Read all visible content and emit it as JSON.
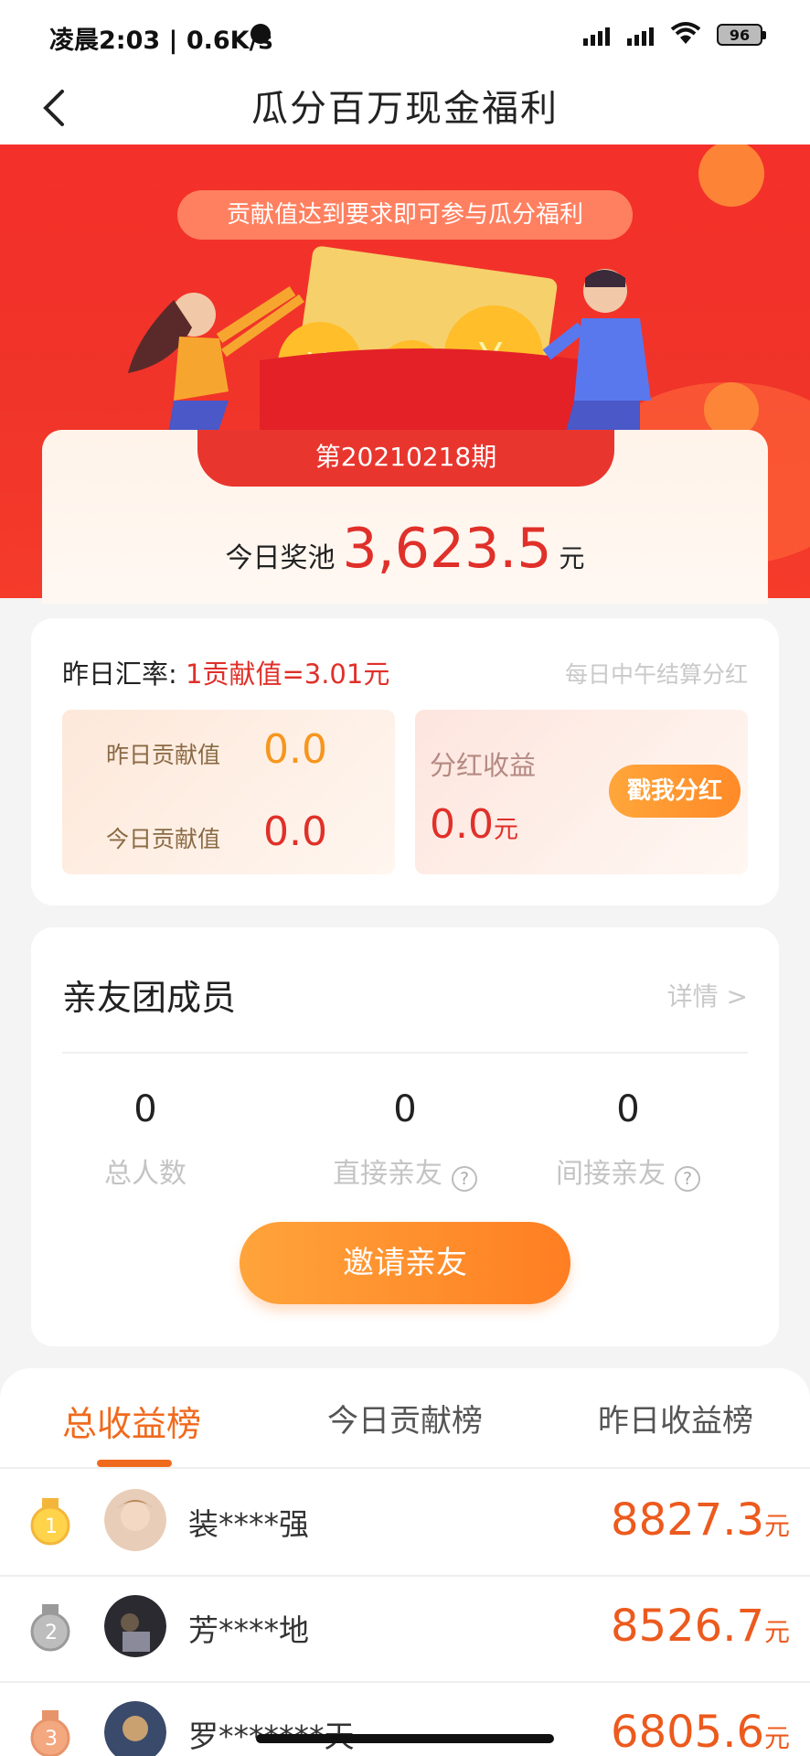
{
  "status_bar": {
    "time": "凌晨2:03 | 0.6K/s",
    "battery": "96"
  },
  "header": {
    "title": "瓜分百万现金福利"
  },
  "hero": {
    "banner_text": "贡献值达到要求即可参与瓜分福利",
    "period": "第20210218期",
    "pool_label": "今日奖池",
    "pool_value": "3,623.5",
    "pool_unit": "元"
  },
  "dividend": {
    "rate_label": "昨日汇率:",
    "rate_value": "1贡献值=3.01元",
    "settle_note": "每日中午结算分红",
    "yesterday_label": "昨日贡献值",
    "yesterday_value": "0.0",
    "today_label": "今日贡献值",
    "today_value": "0.0",
    "income_label": "分红收益",
    "income_value": "0.0",
    "income_unit": "元",
    "claim_button": "戳我分红"
  },
  "team": {
    "title": "亲友团成员",
    "details_link": "详情 >",
    "stats": [
      {
        "value": "0",
        "label": "总人数"
      },
      {
        "value": "0",
        "label": "直接亲友"
      },
      {
        "value": "0",
        "label": "间接亲友"
      }
    ],
    "invite_button": "邀请亲友"
  },
  "ranking": {
    "tabs": [
      "总收益榜",
      "今日贡献榜",
      "昨日收益榜"
    ],
    "active_tab": 0,
    "rows": [
      {
        "rank": "1",
        "name": "装****强",
        "value": "8827.3",
        "unit": "元"
      },
      {
        "rank": "2",
        "name": "芳****地",
        "value": "8526.7",
        "unit": "元"
      },
      {
        "rank": "3",
        "name": "罗*******天",
        "value": "6805.6",
        "unit": "元"
      }
    ]
  },
  "colors": {
    "primary_red": "#e0302a",
    "accent_orange": "#f06a1e",
    "button_orange": "#ff8a28"
  }
}
